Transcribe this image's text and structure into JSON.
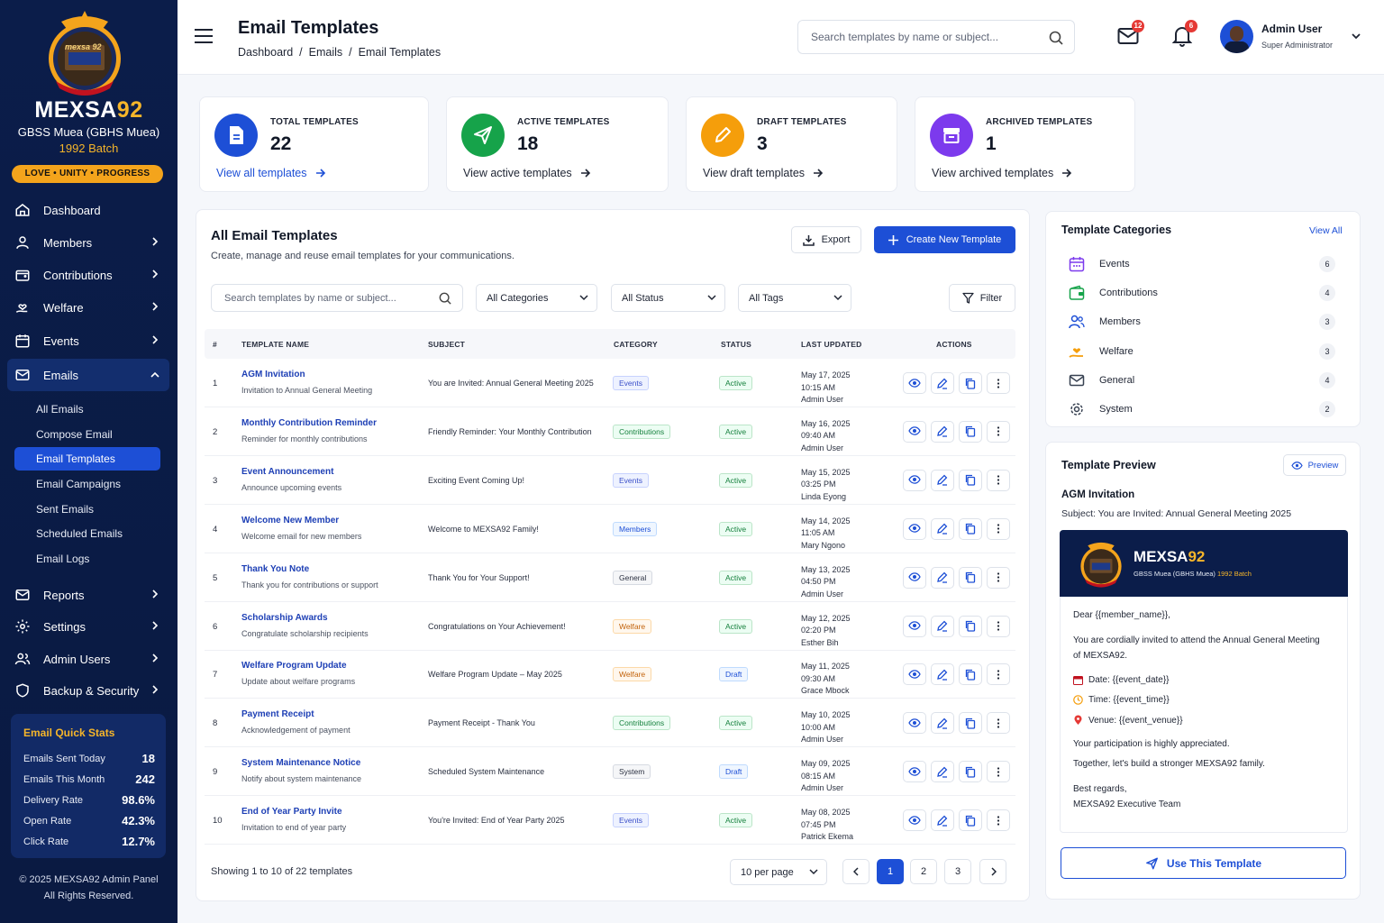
{
  "sidebar": {
    "brand_name_1": "MEXSA",
    "brand_name_2": "92",
    "school": "GBSS Muea (GBHS Muea)",
    "batch": "1992 Batch",
    "motto": "LOVE • UNITY • PROGRESS",
    "logo_text": "mexsa 92",
    "nav": {
      "dashboard": "Dashboard",
      "members": "Members",
      "contributions": "Contributions",
      "welfare": "Welfare",
      "events": "Events",
      "emails": "Emails",
      "reports": "Reports",
      "settings": "Settings",
      "admin_users": "Admin Users",
      "backup": "Backup & Security"
    },
    "email_sub": [
      "All Emails",
      "Compose Email",
      "Email Templates",
      "Email Campaigns",
      "Sent Emails",
      "Scheduled Emails",
      "Email Logs"
    ],
    "quick_stats": {
      "title": "Email Quick Stats",
      "rows": [
        {
          "label": "Emails Sent Today",
          "value": "18"
        },
        {
          "label": "Emails This Month",
          "value": "242"
        },
        {
          "label": "Delivery Rate",
          "value": "98.6%"
        },
        {
          "label": "Open Rate",
          "value": "42.3%"
        },
        {
          "label": "Click Rate",
          "value": "12.7%"
        }
      ]
    },
    "footer_1": "© 2025 MEXSA92 Admin Panel",
    "footer_2": "All Rights Reserved."
  },
  "header": {
    "title": "Email Templates",
    "breadcrumb": [
      "Dashboard",
      "/",
      "Emails",
      "/",
      "Email Templates"
    ],
    "search_placeholder": "Search templates by name or subject...",
    "mail_badge": "12",
    "bell_badge": "6",
    "user_name": "Admin User",
    "user_role": "Super Administrator"
  },
  "stats": [
    {
      "label": "TOTAL TEMPLATES",
      "value": "22",
      "link": "View all templates",
      "color": "#1d4fd6"
    },
    {
      "label": "ACTIVE TEMPLATES",
      "value": "18",
      "link": "View active templates",
      "color": "#16a34a"
    },
    {
      "label": "DRAFT TEMPLATES",
      "value": "3",
      "link": "View draft templates",
      "color": "#f59e0b"
    },
    {
      "label": "ARCHIVED TEMPLATES",
      "value": "1",
      "link": "View archived templates",
      "color": "#7c3aed"
    }
  ],
  "list": {
    "title": "All Email Templates",
    "subtitle": "Create, manage and reuse email templates for your communications.",
    "export_label": "Export",
    "create_label": "Create New Template",
    "search_placeholder": "Search templates by name or subject...",
    "filters": [
      "All Categories",
      "All Status",
      "All Tags"
    ],
    "filter_label": "Filter",
    "columns": [
      "#",
      "TEMPLATE NAME",
      "SUBJECT",
      "CATEGORY",
      "STATUS",
      "LAST UPDATED",
      "ACTIONS"
    ],
    "rows": [
      {
        "n": "1",
        "name": "AGM Invitation",
        "desc": "Invitation to Annual General Meeting",
        "subject": "You are Invited: Annual General Meeting 2025",
        "category": "Events",
        "status": "Active",
        "date": "May 17, 2025",
        "time": "10:15 AM",
        "by": "Admin User"
      },
      {
        "n": "2",
        "name": "Monthly Contribution Reminder",
        "desc": "Reminder for monthly contributions",
        "subject": "Friendly Reminder: Your Monthly Contribution",
        "category": "Contributions",
        "status": "Active",
        "date": "May 16, 2025",
        "time": "09:40 AM",
        "by": "Admin User"
      },
      {
        "n": "3",
        "name": "Event Announcement",
        "desc": "Announce upcoming events",
        "subject": "Exciting Event Coming Up!",
        "category": "Events",
        "status": "Active",
        "date": "May 15, 2025",
        "time": "03:25 PM",
        "by": "Linda Eyong"
      },
      {
        "n": "4",
        "name": "Welcome New Member",
        "desc": "Welcome email for new members",
        "subject": "Welcome to MEXSA92 Family!",
        "category": "Members",
        "status": "Active",
        "date": "May 14, 2025",
        "time": "11:05 AM",
        "by": "Mary Ngono"
      },
      {
        "n": "5",
        "name": "Thank You Note",
        "desc": "Thank you for contributions or support",
        "subject": "Thank You for Your Support!",
        "category": "General",
        "status": "Active",
        "date": "May 13, 2025",
        "time": "04:50 PM",
        "by": "Admin User"
      },
      {
        "n": "6",
        "name": "Scholarship Awards",
        "desc": "Congratulate scholarship recipients",
        "subject": "Congratulations on Your Achievement!",
        "category": "Welfare",
        "status": "Active",
        "date": "May 12, 2025",
        "time": "02:20 PM",
        "by": "Esther Bih"
      },
      {
        "n": "7",
        "name": "Welfare Program Update",
        "desc": "Update about welfare programs",
        "subject": "Welfare Program Update – May 2025",
        "category": "Welfare",
        "status": "Draft",
        "date": "May 11, 2025",
        "time": "09:30 AM",
        "by": "Grace Mbock"
      },
      {
        "n": "8",
        "name": "Payment Receipt",
        "desc": "Acknowledgement of payment",
        "subject": "Payment Receipt - Thank You",
        "category": "Contributions",
        "status": "Active",
        "date": "May 10, 2025",
        "time": "10:00 AM",
        "by": "Admin User"
      },
      {
        "n": "9",
        "name": "System Maintenance Notice",
        "desc": "Notify about system maintenance",
        "subject": "Scheduled System Maintenance",
        "category": "System",
        "status": "Draft",
        "date": "May 09, 2025",
        "time": "08:15 AM",
        "by": "Admin User"
      },
      {
        "n": "10",
        "name": "End of Year Party Invite",
        "desc": "Invitation to end of year party",
        "subject": "You're Invited: End of Year Party 2025",
        "category": "Events",
        "status": "Active",
        "date": "May 08, 2025",
        "time": "07:45 PM",
        "by": "Patrick Ekema"
      }
    ],
    "showing": "Showing 1 to 10 of 22 templates",
    "per_page": "10 per page",
    "pages": [
      "1",
      "2",
      "3"
    ]
  },
  "categories": {
    "title": "Template Categories",
    "view_all": "View All",
    "items": [
      {
        "name": "Events",
        "count": "6",
        "icon": "calendar-icon",
        "color": "#7c3aed"
      },
      {
        "name": "Contributions",
        "count": "4",
        "icon": "wallet-icon",
        "color": "#16a34a"
      },
      {
        "name": "Members",
        "count": "3",
        "icon": "users-icon",
        "color": "#1d4fd6"
      },
      {
        "name": "Welfare",
        "count": "3",
        "icon": "hand-heart-icon",
        "color": "#f59e0b"
      },
      {
        "name": "General",
        "count": "4",
        "icon": "mail-icon",
        "color": "#374151"
      },
      {
        "name": "System",
        "count": "2",
        "icon": "gear-icon",
        "color": "#374151"
      }
    ]
  },
  "preview": {
    "title": "Template Preview",
    "preview_btn": "Preview",
    "template_name": "AGM Invitation",
    "subject": "Subject: You are Invited: Annual General Meeting 2025",
    "banner_brand_1": "MEXSA",
    "banner_brand_2": "92",
    "banner_school": "GBSS Muea (GBHS Muea)",
    "banner_batch": "1992 Batch",
    "greeting": "Dear {{member_name}},",
    "body_1": "You are cordially invited to attend the Annual General Meeting",
    "body_2": "of MEXSA92.",
    "date_line": "Date: {{event_date}}",
    "time_line": "Time: {{event_time}}",
    "venue_line": "Venue: {{event_venue}}",
    "appreciation": "Your participation is highly appreciated.",
    "together": "Together, let's build a stronger MEXSA92 family.",
    "regards": "Best regards,",
    "team": "MEXSA92 Executive Team",
    "use_btn": "Use This Template"
  }
}
